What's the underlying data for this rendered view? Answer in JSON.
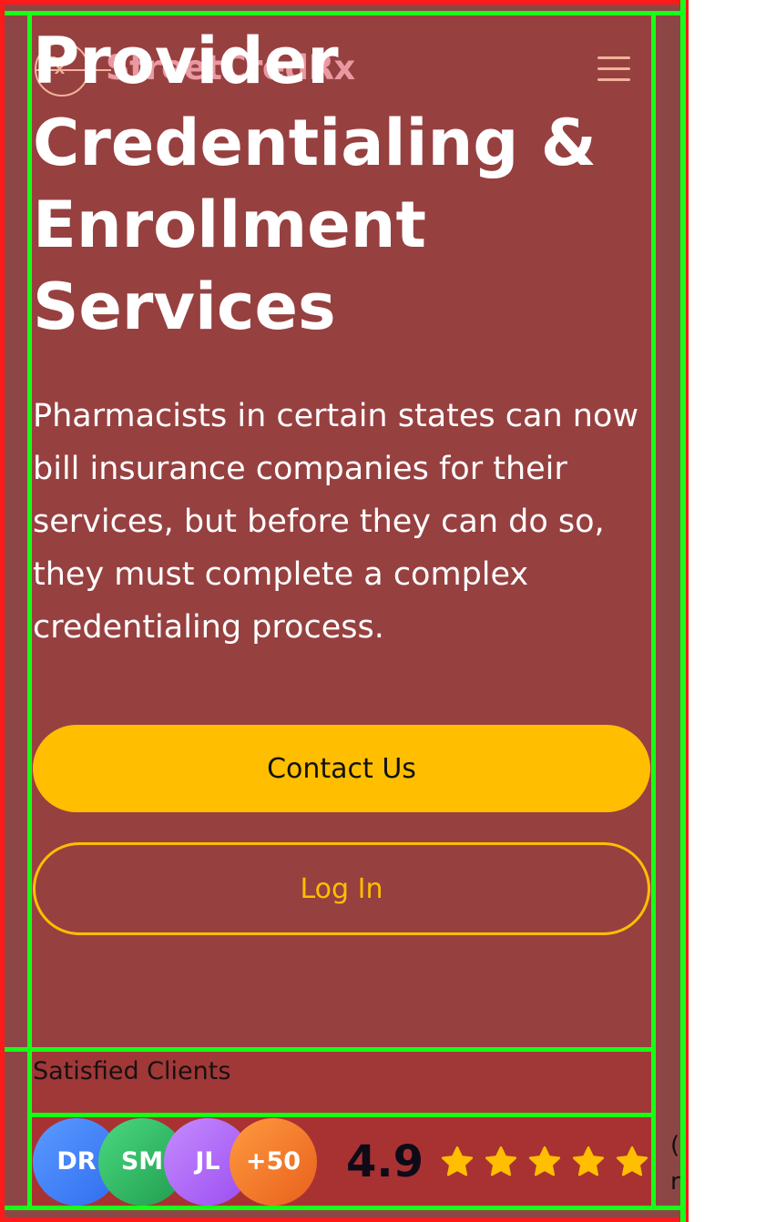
{
  "header": {
    "brand": "StreetCredRx",
    "logo_glyph": "℞",
    "menu_icon": "hamburger-menu-icon"
  },
  "hero": {
    "title": "Provider Credentialing & Enrollment Services",
    "description": "Pharmacists in certain states can now bill insurance companies for their services, but before they can do so, they must complete a complex credentialing process.",
    "contact_label": "Contact Us",
    "login_label": "Log In"
  },
  "social_proof": {
    "label": "Satisfied Clients",
    "avatars": [
      "DR",
      "SM",
      "JL",
      "+50"
    ],
    "rating": "4.9",
    "stars": 5,
    "reviews_fragment_1": "(",
    "reviews_fragment_2": "r"
  },
  "colors": {
    "accent": "#ffbe00",
    "hero_bg": "#974040",
    "brand_text": "#f3a3ad"
  }
}
